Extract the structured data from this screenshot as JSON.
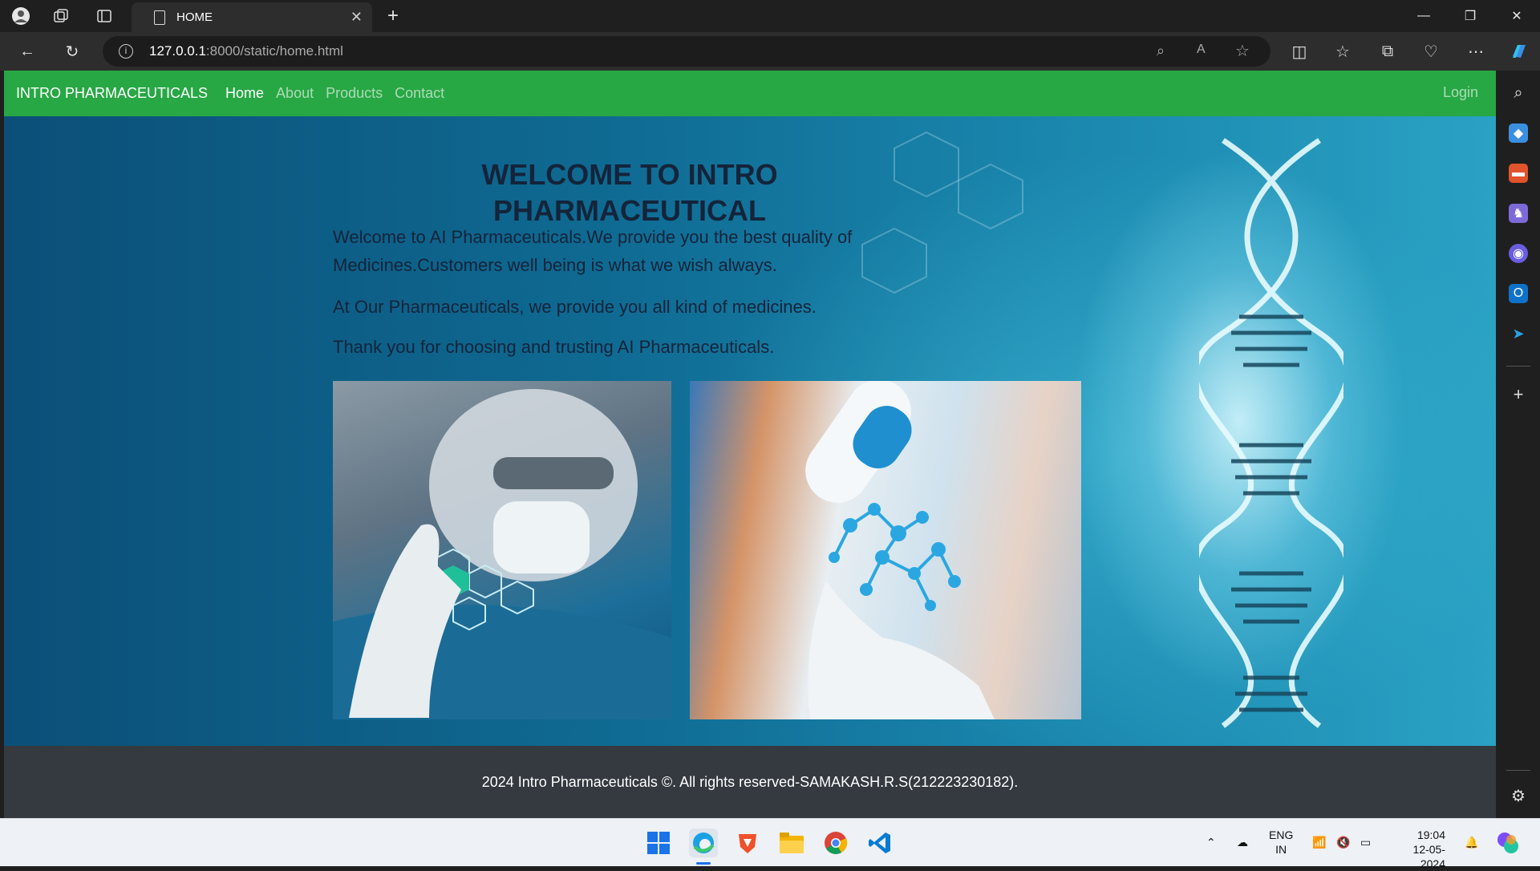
{
  "browser": {
    "tab_title": "HOME",
    "url_host": "127.0.0.1",
    "url_path": ":8000/static/home.html"
  },
  "navbar": {
    "brand": "INTRO PHARMACEUTICALS",
    "links": [
      "Home",
      "About",
      "Products",
      "Contact"
    ],
    "active": "Home",
    "login": "Login"
  },
  "main": {
    "heading_line1": "WELCOME TO INTRO",
    "heading_line2": "PHARMACEUTICAL",
    "para1": "Welcome to AI Pharmaceuticals.We provide you the best quality of Medicines.Customers well being is what we wish always.",
    "para2": "At Our Pharmaceuticals, we provide you all kind of medicines.",
    "para3": "Thank you for choosing and trusting AI Pharmaceuticals."
  },
  "footer": {
    "text": "2024 Intro Pharmaceuticals ©. All rights reserved-SAMAKASH.R.S(212223230182)."
  },
  "taskbar": {
    "lang_line1": "ENG",
    "lang_line2": "IN",
    "time": "19:04",
    "date": "12-05-2024"
  },
  "colors": {
    "navbar": "#28a745",
    "footer": "#343a40",
    "heading": "#14243a"
  }
}
